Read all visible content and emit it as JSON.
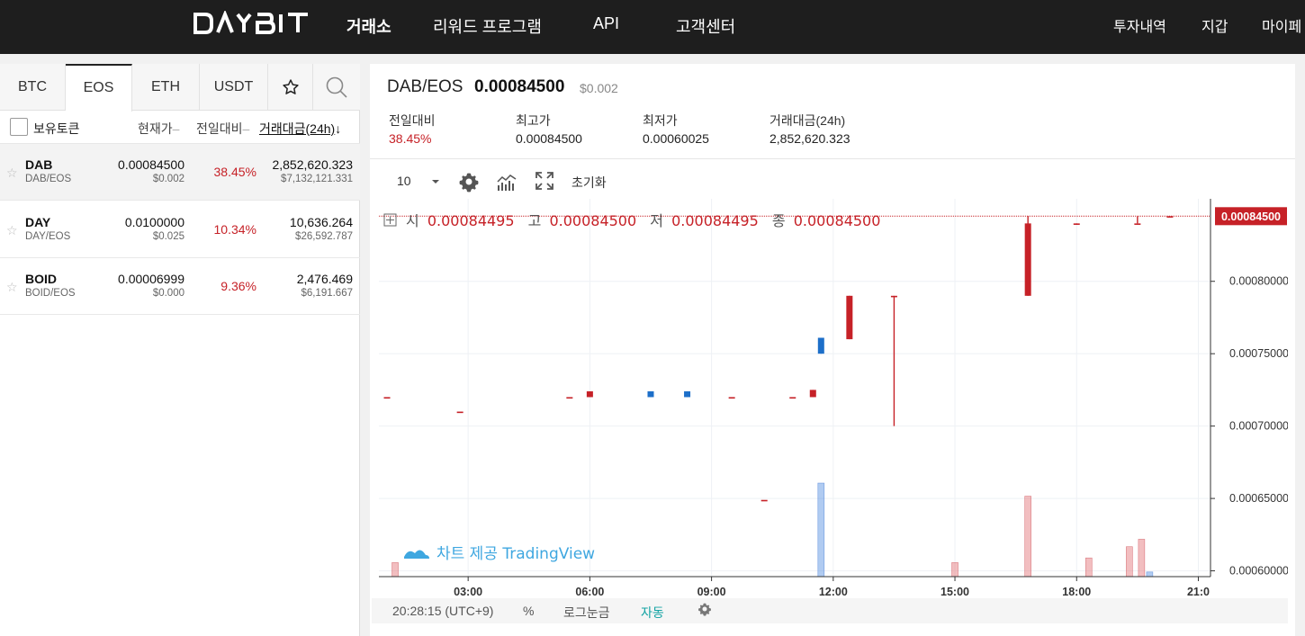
{
  "brand": {
    "logo_text": "DAYBIT"
  },
  "nav": {
    "items": [
      {
        "label": "거래소",
        "active": true
      },
      {
        "label": "리워드 프로그램"
      },
      {
        "label": "API"
      },
      {
        "label": "고객센터"
      }
    ],
    "right": [
      "투자내역",
      "지갑",
      "마이페"
    ]
  },
  "market_tabs": [
    "BTC",
    "EOS",
    "ETH",
    "USDT"
  ],
  "market_tab_active": "EOS",
  "list_header": {
    "holdings_label": "보유토큰",
    "price_label": "현재가",
    "change_label": "전일대비",
    "volume_label": "거래대금(24h)",
    "sort_arrow": "↓",
    "dash": "–"
  },
  "tokens": [
    {
      "symbol": "DAB",
      "pair": "DAB/EOS",
      "price": "0.00084500",
      "usd": "$0.002",
      "change": "38.45%",
      "volume": "2,852,620.323",
      "volume_usd": "$7,132,121.331"
    },
    {
      "symbol": "DAY",
      "pair": "DAY/EOS",
      "price": "0.0100000",
      "usd": "$0.025",
      "change": "10.34%",
      "volume": "10,636.264",
      "volume_usd": "$26,592.787"
    },
    {
      "symbol": "BOID",
      "pair": "BOID/EOS",
      "price": "0.00006999",
      "usd": "$0.000",
      "change": "9.36%",
      "volume": "2,476.469",
      "volume_usd": "$6,191.667"
    }
  ],
  "selected": {
    "pair": "DAB/EOS",
    "price": "0.00084500",
    "usd": "$0.002",
    "stats": [
      {
        "label": "전일대비",
        "value": "38.45%"
      },
      {
        "label": "최고가",
        "value": "0.00084500"
      },
      {
        "label": "최저가",
        "value": "0.00060025"
      },
      {
        "label": "거래대금(24h)",
        "value": "2,852,620.323"
      }
    ]
  },
  "toolbar": {
    "interval": "10",
    "reset_label": "초기화"
  },
  "chart_data": {
    "type": "candlestick",
    "ohlc_legend": [
      {
        "label": "시",
        "value": "0.00084495"
      },
      {
        "label": "고",
        "value": "0.00084500"
      },
      {
        "label": "저",
        "value": "0.00084495"
      },
      {
        "label": "종",
        "value": "0.00084500"
      }
    ],
    "last_price_label": "0.00084500",
    "x_ticks": [
      "03:00",
      "06:00",
      "09:00",
      "12:00",
      "15:00",
      "18:00",
      "21:0"
    ],
    "y_ticks": [
      "0.00080000",
      "0.00075000",
      "0.00070000",
      "0.00065000",
      "0.00060000"
    ],
    "y_range": [
      0.000596,
      0.000857
    ],
    "x_range_hours": [
      0.8,
      21.3
    ],
    "candles": [
      {
        "t": 1.0,
        "o": 0.00072,
        "h": 0.00072,
        "l": 0.00072,
        "c": 0.00072
      },
      {
        "t": 2.8,
        "o": 0.00071,
        "h": 0.00071,
        "l": 0.00071,
        "c": 0.00071
      },
      {
        "t": 5.5,
        "o": 0.00072,
        "h": 0.00072,
        "l": 0.00072,
        "c": 0.00072
      },
      {
        "t": 6.0,
        "o": 0.00072,
        "h": 0.000724,
        "l": 0.00072,
        "c": 0.000724
      },
      {
        "t": 7.5,
        "o": 0.000724,
        "h": 0.000724,
        "l": 0.00072,
        "c": 0.00072
      },
      {
        "t": 8.4,
        "o": 0.000724,
        "h": 0.000724,
        "l": 0.00072,
        "c": 0.00072
      },
      {
        "t": 9.5,
        "o": 0.00072,
        "h": 0.00072,
        "l": 0.00072,
        "c": 0.00072
      },
      {
        "t": 10.3,
        "o": 0.000649,
        "h": 0.000649,
        "l": 0.000649,
        "c": 0.000649
      },
      {
        "t": 11.0,
        "o": 0.00072,
        "h": 0.00072,
        "l": 0.00072,
        "c": 0.00072
      },
      {
        "t": 11.5,
        "o": 0.00072,
        "h": 0.000725,
        "l": 0.00072,
        "c": 0.000725
      },
      {
        "t": 11.7,
        "o": 0.000761,
        "h": 0.000761,
        "l": 0.00075,
        "c": 0.00075
      },
      {
        "t": 12.4,
        "o": 0.00076,
        "h": 0.00079,
        "l": 0.00076,
        "c": 0.00079
      },
      {
        "t": 13.5,
        "o": 0.00079,
        "h": 0.00079,
        "l": 0.0007,
        "c": 0.00079
      },
      {
        "t": 16.8,
        "o": 0.00079,
        "h": 0.000845,
        "l": 0.00079,
        "c": 0.00084
      },
      {
        "t": 18.0,
        "o": 0.00084,
        "h": 0.00084,
        "l": 0.000839,
        "c": 0.00084
      },
      {
        "t": 19.5,
        "o": 0.00084,
        "h": 0.000845,
        "l": 0.00084,
        "c": 0.00084
      },
      {
        "t": 20.3,
        "o": 0.000845,
        "h": 0.000845,
        "l": 0.000845,
        "c": 0.000845
      }
    ],
    "volumes": [
      {
        "t": 1.2,
        "v": 0.15,
        "up": true
      },
      {
        "t": 11.7,
        "v": 1.0,
        "up": false
      },
      {
        "t": 15.0,
        "v": 0.15,
        "up": true
      },
      {
        "t": 16.8,
        "v": 0.86,
        "up": true
      },
      {
        "t": 18.3,
        "v": 0.2,
        "up": true
      },
      {
        "t": 19.3,
        "v": 0.32,
        "up": true
      },
      {
        "t": 19.6,
        "v": 0.4,
        "up": true
      },
      {
        "t": 19.8,
        "v": 0.05,
        "up": false
      }
    ],
    "grid": true,
    "watermark": "차트 제공 TradingView"
  },
  "status_bar": {
    "time": "20:28:15 (UTC+9)",
    "percent": "%",
    "log_scale": "로그눈금",
    "auto": "자동"
  },
  "colors": {
    "up": "#c62127",
    "down": "#1d6fc9",
    "nav_bg": "#1e1e1e"
  }
}
